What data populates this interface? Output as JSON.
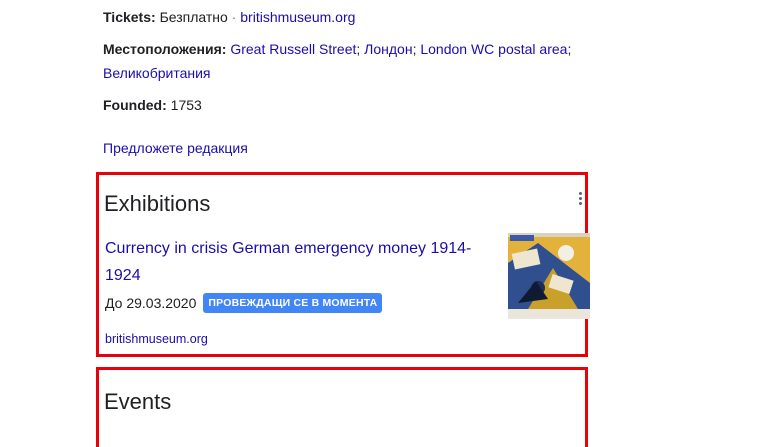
{
  "info": {
    "tickets_label": "Tickets:",
    "tickets_value": "Безплатно",
    "tickets_separator": "·",
    "tickets_link": "britishmuseum.org",
    "location_label": "Местоположения:",
    "location_parts": [
      "Great Russell Street",
      "Лондон",
      "London WC postal area",
      "Великобритания"
    ],
    "location_separator": ";",
    "founded_label": "Founded:",
    "founded_value": "1753"
  },
  "suggest_edit": "Предложете редакция",
  "exhibitions": {
    "title": "Exhibitions",
    "item": {
      "name": "Currency in crisis German emergency money 1914-1924",
      "date": "До 29.03.2020",
      "status": "ПРОВЕЖДАЩИ СЕ В МОМЕНТА",
      "source": "britishmuseum.org",
      "thumbnail": "exhibition-poster-image"
    }
  },
  "events": {
    "title": "Events"
  },
  "colors": {
    "link": "#1a0dab",
    "highlight_border": "#e8000b",
    "badge": "#4285f4"
  }
}
